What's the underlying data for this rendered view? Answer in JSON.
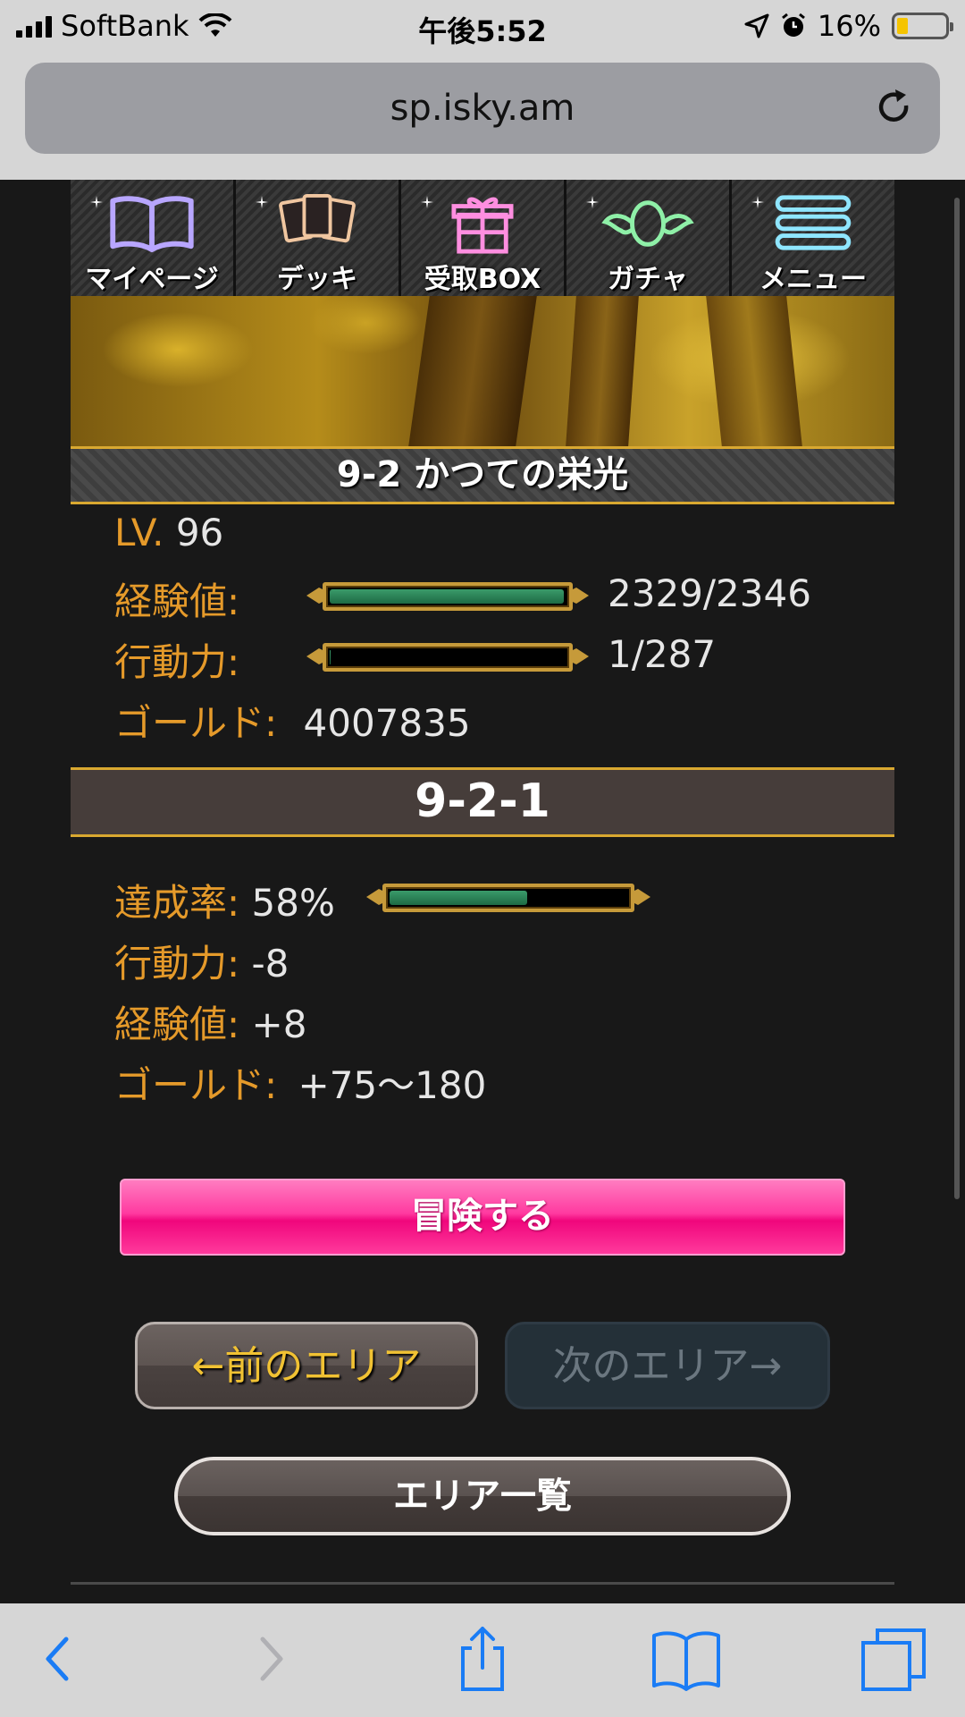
{
  "status_bar": {
    "carrier": "SoftBank",
    "time": "午後5:52",
    "battery": "16%",
    "battery_level": 0.16
  },
  "browser": {
    "url": "sp.isky.am"
  },
  "nav": {
    "items": [
      {
        "label": "マイページ",
        "icon": "book-icon",
        "color": "#b8a6ff"
      },
      {
        "label": "デッキ",
        "icon": "cards-icon",
        "color": "#f0c6a0"
      },
      {
        "label": "受取BOX",
        "icon": "gift-icon",
        "color": "#ff8ee0"
      },
      {
        "label": "ガチャ",
        "icon": "winged-egg-icon",
        "color": "#8ff0a8"
      },
      {
        "label": "メニュー",
        "icon": "menu-icon",
        "color": "#8fe6ff"
      }
    ]
  },
  "area": {
    "title": "9-2 かつての栄光"
  },
  "player": {
    "level_label": "LV.",
    "level_value": "96",
    "exp_label": "経験値:",
    "exp_value": "2329/2346",
    "exp_ratio": 0.9928,
    "ap_label": "行動力:",
    "ap_value": "1/287",
    "ap_ratio": 0.0035,
    "gold_label": "ゴールド:",
    "gold_value": "4007835"
  },
  "stage": {
    "title": "9-2-1",
    "completion_label": "達成率:",
    "completion_value": "58%",
    "completion_ratio": 0.58,
    "ap_cost_label": "行動力:",
    "ap_cost_value": "-8",
    "exp_gain_label": "経験値:",
    "exp_gain_value": "+8",
    "gold_gain_label": "ゴールド:",
    "gold_gain_value": "+75〜180"
  },
  "buttons": {
    "adventure": "冒険する",
    "prev_area": "←前のエリア",
    "next_area": "次のエリア→",
    "area_list": "エリア一覧"
  },
  "colors": {
    "label_orange": "#e59a2a",
    "gold_border": "#d9a830",
    "primary_pink": "#f0067c"
  }
}
